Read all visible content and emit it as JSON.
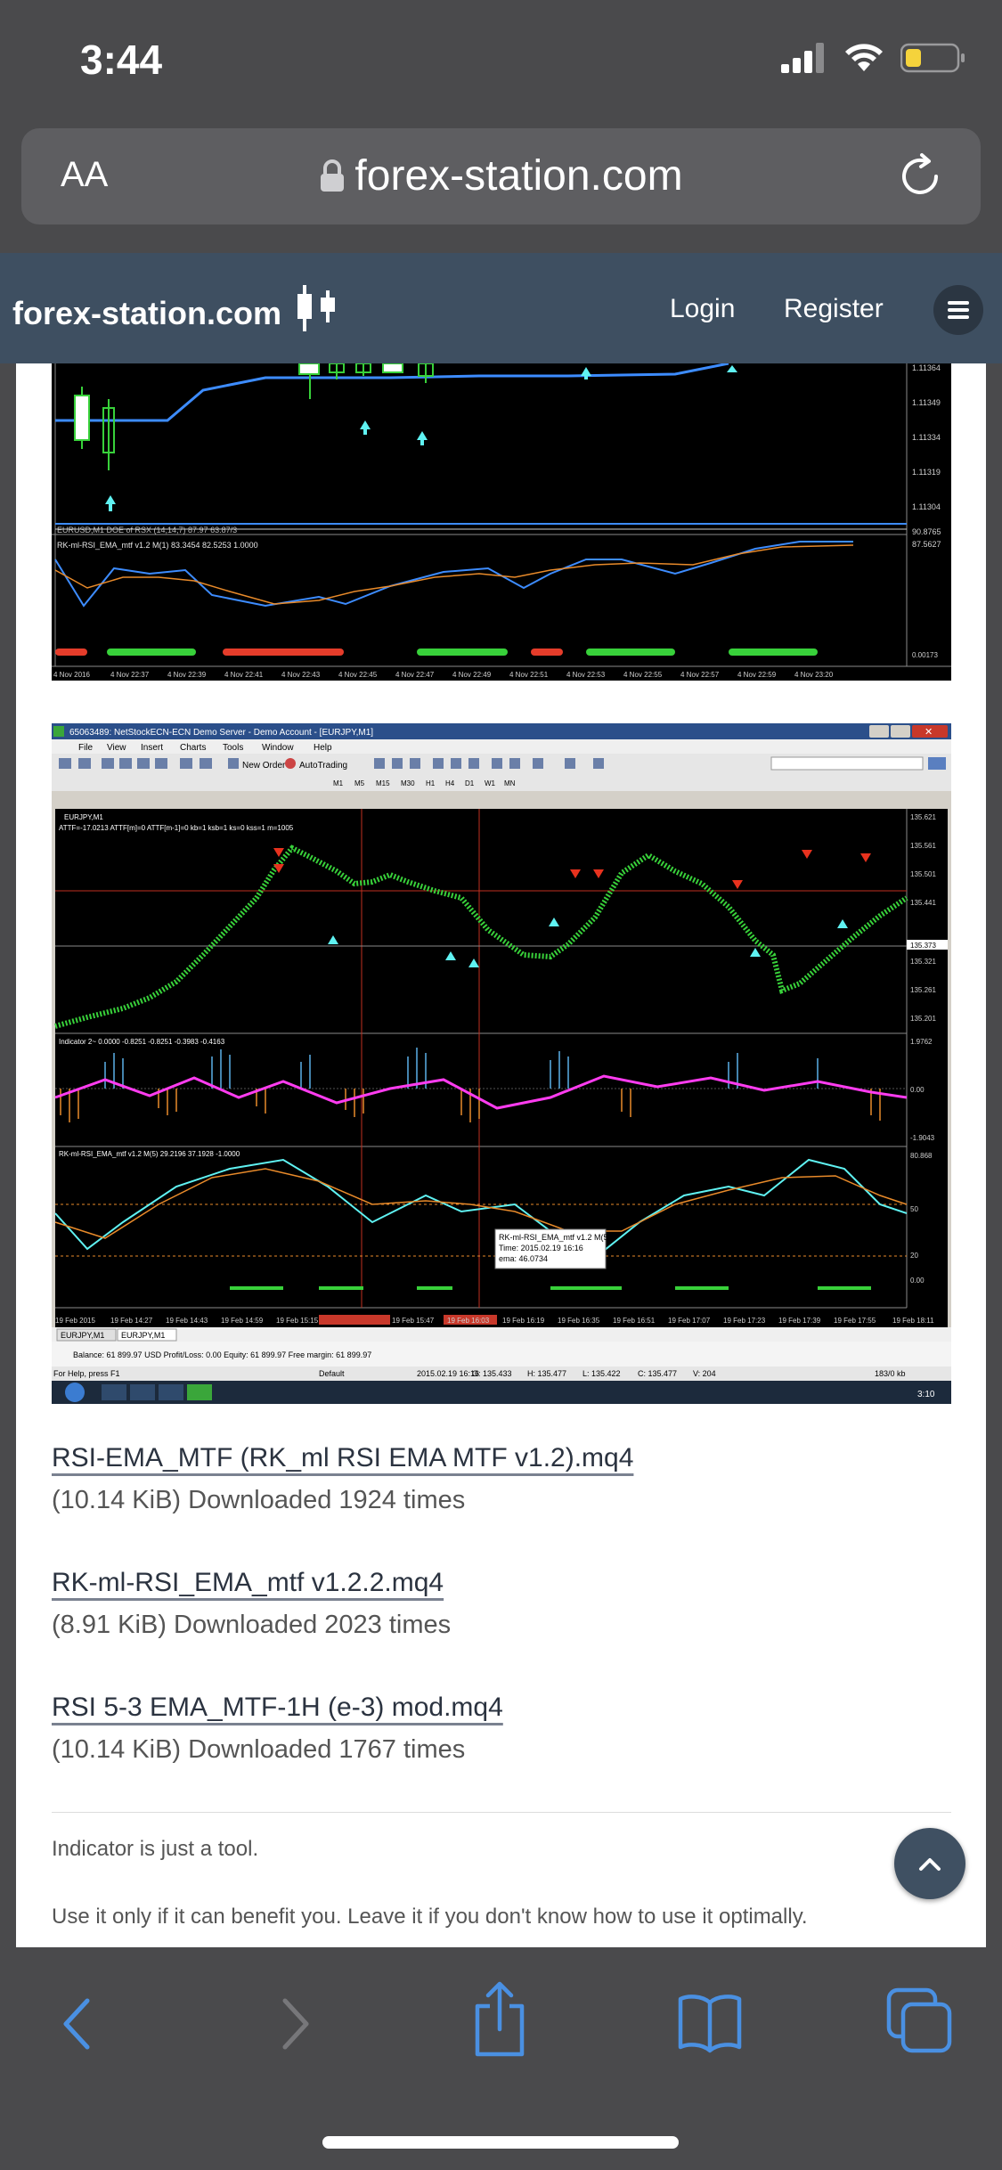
{
  "status_bar": {
    "time": "3:44"
  },
  "browser": {
    "text_size_label": "AA",
    "url": "forex-station.com"
  },
  "site_nav": {
    "logo": "forex-station.com",
    "login": "Login",
    "register": "Register"
  },
  "chart1": {
    "title": "EURUSD,M1 DOE of RSX (14,14,7) 87.97 63.87/3",
    "indicator": "RK-ml-RSI_EMA_mtf v1.2 M(1) 83.3454 82.5253 1.0000",
    "price_ticks": [
      "1.11364",
      "1.11349",
      "1.11334",
      "1.11319",
      "1.11304"
    ],
    "ind_ticks": [
      "90.8765",
      "87.5627"
    ],
    "time_ticks": [
      "4 Nov 2016",
      "4 Nov 22:37",
      "4 Nov 22:39",
      "4 Nov 22:41",
      "4 Nov 22:43",
      "4 Nov 22:45",
      "4 Nov 22:47",
      "4 Nov 22:49",
      "4 Nov 22:51",
      "4 Nov 22:53",
      "4 Nov 22:55",
      "4 Nov 22:57",
      "4 Nov 22:59",
      "4 Nov 23:20"
    ]
  },
  "chart2": {
    "window_title": "65063489: NetStockECN-ECN Demo Server - Demo Account - [EURJPY,M1]",
    "menu": [
      "File",
      "View",
      "Insert",
      "Charts",
      "Tools",
      "Window",
      "Help"
    ],
    "new_order": "New Order",
    "autotrading": "AutoTrading",
    "periods": [
      "M1",
      "M5",
      "M15",
      "M30",
      "H1",
      "H4",
      "D1",
      "W1",
      "MN"
    ],
    "symbol": "EURJPY,M1",
    "attf": "ATTF=-17.0213 ATTF[m]=0 ATTF[m-1]=0 kb=1 ksb=1 ks=0 kss=1 m=1005",
    "price_ticks": [
      "135.621",
      "135.561",
      "135.501",
      "135.441",
      "135.373",
      "135.321",
      "135.261",
      "135.201"
    ],
    "indicator2": "Indicator 2~ 0.0000 -0.8251 -0.8251 -0.3983 -0.4163",
    "ind2_ticks": [
      "1.9762",
      "0.00",
      "-1.9043"
    ],
    "rsi": "RK-ml-RSI_EMA_mtf v1.2 M(5) 29.2196 37.1928 -1.0000",
    "rsi_ticks": [
      "80.868",
      "50",
      "20",
      "0.00"
    ],
    "tooltip": [
      "RK-ml-RSI_EMA_mtf v1.2 M(5)",
      "Time: 2015.02.19 16:16",
      "ema: 46.0734"
    ],
    "time_ticks": [
      "19 Feb 2015",
      "19 Feb 14:27",
      "19 Feb 14:43",
      "19 Feb 14:59",
      "19 Feb 15:15",
      "19 Feb 15:47",
      "19 Feb 16:03",
      "19 Feb 16:19",
      "19 Feb 16:35",
      "19 Feb 16:51",
      "19 Feb 17:07",
      "19 Feb 17:23",
      "19 Feb 17:39",
      "19 Feb 17:55",
      "19 Feb 18:11"
    ],
    "tabs": [
      "EURJPY,M1",
      "EURJPY,M1"
    ],
    "balance": "Balance: 61 899.97 USD  Profit/Loss: 0.00  Equity: 61 899.97  Free margin: 61 899.97",
    "help": "For Help, press F1",
    "default": "Default",
    "status_date": "2015.02.19 16:16",
    "open": "O: 135.433",
    "high": "H: 135.477",
    "low": "L: 135.422",
    "close": "C: 135.477",
    "volume": "V: 204",
    "traffic": "183/0 kb",
    "clock": "3:10"
  },
  "attachments": [
    {
      "name": "RSI-EMA_MTF (RK_ml RSI EMA MTF v1.2).mq4",
      "info": "(10.14 KiB) Downloaded 1924 times"
    },
    {
      "name": "RK-ml-RSI_EMA_mtf v1.2.2.mq4",
      "info": "(8.91 KiB) Downloaded 2023 times"
    },
    {
      "name": "RSI 5-3 EMA_MTF-1H (e-3) mod.mq4",
      "info": "(10.14 KiB) Downloaded 1767 times"
    }
  ],
  "signature": {
    "line1": "Indicator is just a tool.",
    "line2": "Use it only if it can benefit you. Leave it if you don't know how to use it optimally."
  },
  "colors": {
    "nav_bg": "#3e4f61",
    "ios_blue": "#4a90e2",
    "chart_bg": "#000000",
    "candle_green": "#38d13a",
    "line_blue": "#3d8cff",
    "line_orange": "#e88a2a",
    "cyan": "#5ff2f2",
    "magenta": "#ff3cf0"
  }
}
